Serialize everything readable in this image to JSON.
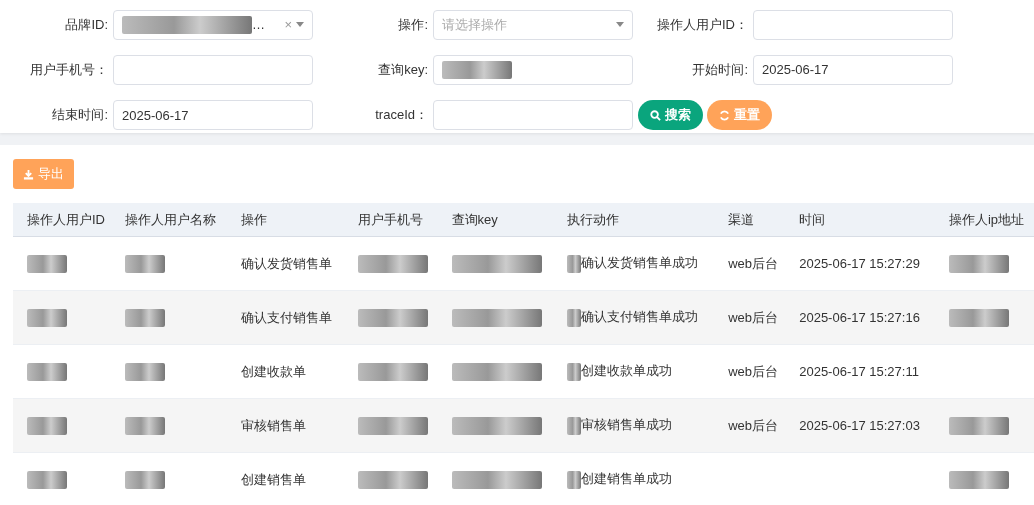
{
  "filters": {
    "brand": {
      "label": "品牌ID:",
      "value": "…",
      "clear": "×"
    },
    "operation": {
      "label": "操作:",
      "placeholder": "请选择操作"
    },
    "operator_id": {
      "label": "操作人用户ID："
    },
    "phone": {
      "label": "用户手机号："
    },
    "query_key": {
      "label": "查询key:"
    },
    "start_time": {
      "label": "开始时间:",
      "value": "2025-06-17"
    },
    "end_time": {
      "label": "结束时间:",
      "value": "2025-06-17"
    },
    "trace_id": {
      "label": "traceId："
    },
    "search_button": "搜索",
    "reset_button": "重置"
  },
  "export_button": "导出",
  "table": {
    "columns": [
      "操作人用户ID",
      "操作人用户名称",
      "操作",
      "用户手机号",
      "查询key",
      "执行动作",
      "渠道",
      "时间",
      "操作人ip地址"
    ],
    "rows": [
      {
        "operation": "确认发货销售单",
        "action": "确认发货销售单成功",
        "channel": "web后台",
        "time": "2025-06-17 15:27:29"
      },
      {
        "operation": "确认支付销售单",
        "action": "确认支付销售单成功",
        "channel": "web后台",
        "time": "2025-06-17 15:27:16"
      },
      {
        "operation": "创建收款单",
        "action": "创建收款单成功",
        "channel": "web后台",
        "time": "2025-06-17 15:27:11"
      },
      {
        "operation": "审核销售单",
        "action": "审核销售单成功",
        "channel": "web后台",
        "time": "2025-06-17 15:27:03"
      },
      {
        "operation": "创建销售单",
        "action": "创建销售单成功"
      }
    ]
  }
}
